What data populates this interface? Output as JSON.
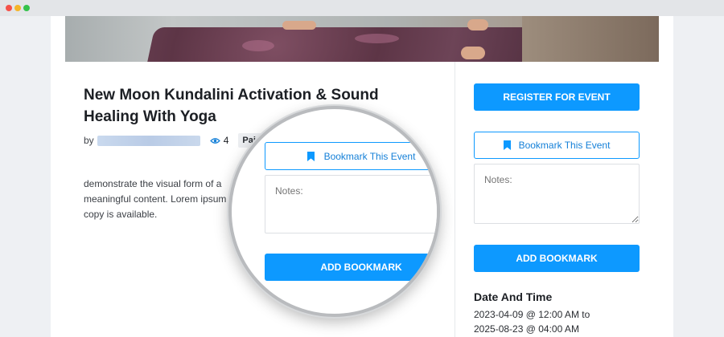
{
  "event": {
    "title": "New Moon Kundalini Activation & Sound Healing With Yoga",
    "by_label": "by",
    "views": "4",
    "price_badge": "Paid",
    "description": "demonstrate the visual form of a meaningful content. Lorem ipsum copy is available."
  },
  "sidebar": {
    "register_label": "REGISTER FOR EVENT",
    "bookmark_label": "Bookmark This Event",
    "notes_placeholder": "Notes:",
    "add_bookmark_label": "ADD BOOKMARK",
    "datetime_heading": "Date And Time",
    "datetime_start": "2023-04-09 @ 12:00 AM to",
    "datetime_end": "2025-08-23 @ 04:00 AM"
  },
  "magnifier": {
    "bookmark_label": "Bookmark This Event",
    "notes_placeholder": "Notes:",
    "add_bookmark_label": "ADD BOOKMARK"
  },
  "colors": {
    "accent": "#0d99ff",
    "page_bg": "#eef0f3"
  },
  "icons": {
    "views": "eye-icon",
    "bookmark": "bookmark-icon"
  }
}
